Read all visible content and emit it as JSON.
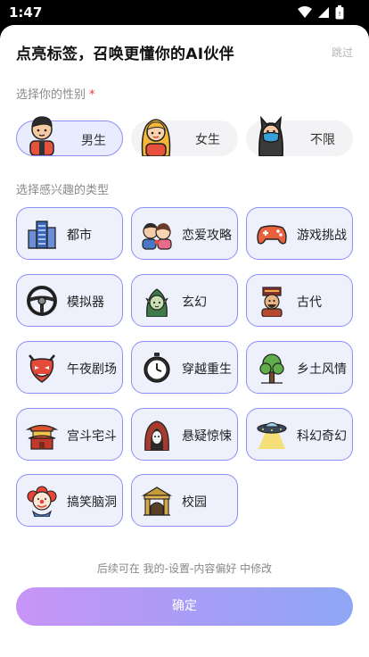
{
  "status": {
    "time": "1:47"
  },
  "header": {
    "title": "点亮标签，召唤更懂你的AI伙伴",
    "skip_label": "跳过"
  },
  "gender_section": {
    "label": "选择你的性别",
    "required_mark": "*"
  },
  "genders": [
    {
      "label": "男生",
      "selected": true,
      "icon": "boy-avatar-icon"
    },
    {
      "label": "女生",
      "selected": false,
      "icon": "girl-avatar-icon"
    },
    {
      "label": "不限",
      "selected": false,
      "icon": "masked-figure-icon"
    }
  ],
  "interest_section": {
    "label": "选择感兴趣的类型"
  },
  "interests": [
    {
      "label": "都市",
      "icon": "city-building-icon"
    },
    {
      "label": "恋爱攻略",
      "icon": "couple-icon"
    },
    {
      "label": "游戏挑战",
      "icon": "gamepad-icon"
    },
    {
      "label": "模拟器",
      "icon": "steering-wheel-icon"
    },
    {
      "label": "玄幻",
      "icon": "elf-icon"
    },
    {
      "label": "古代",
      "icon": "ancient-official-icon"
    },
    {
      "label": "午夜剧场",
      "icon": "demon-mask-icon"
    },
    {
      "label": "穿越重生",
      "icon": "stopwatch-icon"
    },
    {
      "label": "乡土风情",
      "icon": "tree-icon"
    },
    {
      "label": "宫斗宅斗",
      "icon": "palace-icon"
    },
    {
      "label": "悬疑惊悚",
      "icon": "hooded-ghost-icon"
    },
    {
      "label": "科幻奇幻",
      "icon": "ufo-icon"
    },
    {
      "label": "搞笑脑洞",
      "icon": "clown-icon"
    },
    {
      "label": "校园",
      "icon": "school-gate-icon"
    }
  ],
  "footer": {
    "hint": "后续可在 我的-设置-内容偏好 中修改",
    "confirm_label": "确定"
  },
  "colors": {
    "accent": "#8c8ff3",
    "tile_bg": "#eef0fc",
    "button_start": "#c894f7",
    "button_end": "#8ea7f5"
  }
}
